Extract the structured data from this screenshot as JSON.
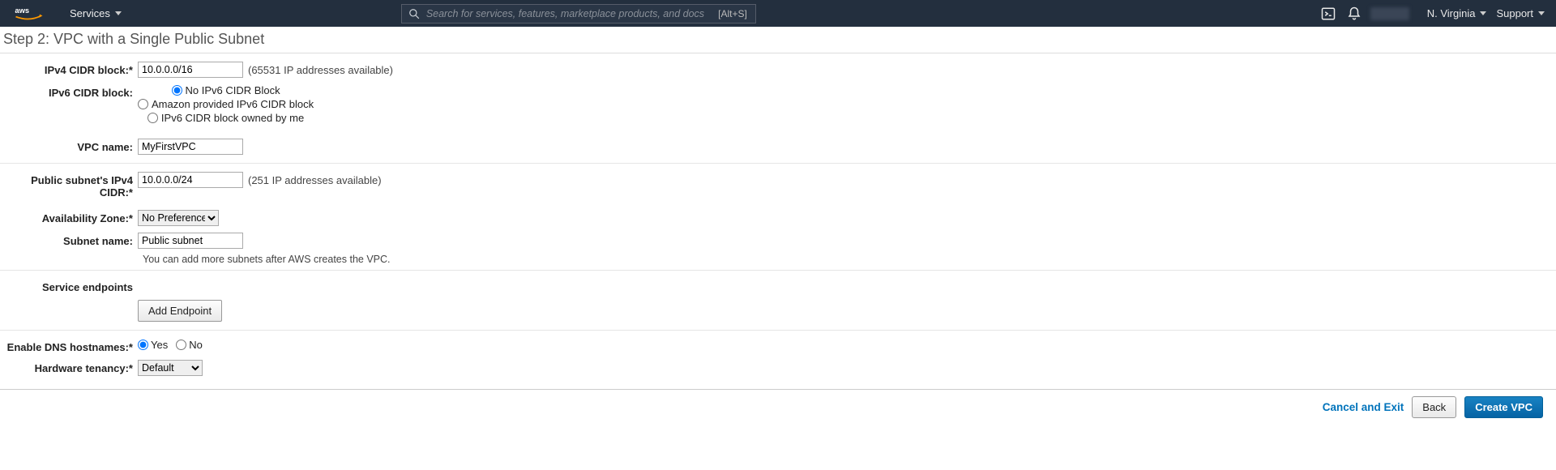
{
  "nav": {
    "services_label": "Services",
    "search_placeholder": "Search for services, features, marketplace products, and docs",
    "search_kbd": "[Alt+S]",
    "region": "N. Virginia",
    "support": "Support"
  },
  "page": {
    "title": "Step 2: VPC with a Single Public Subnet"
  },
  "form": {
    "ipv4_label": "IPv4 CIDR block:*",
    "ipv4_value": "10.0.0.0/16",
    "ipv4_help": "(65531 IP addresses available)",
    "ipv6_label": "IPv6 CIDR block:",
    "ipv6_opt_none": "No IPv6 CIDR Block",
    "ipv6_opt_amazon": "Amazon provided IPv6 CIDR block",
    "ipv6_opt_owned": "IPv6 CIDR block owned by me",
    "vpc_name_label": "VPC name:",
    "vpc_name_value": "MyFirstVPC",
    "ps_ipv4_label": "Public subnet's IPv4 CIDR:*",
    "ps_ipv4_value": "10.0.0.0/24",
    "ps_ipv4_help": "(251 IP addresses available)",
    "az_label": "Availability Zone:*",
    "az_value": "No Preference",
    "subnet_name_label": "Subnet name:",
    "subnet_name_value": "Public subnet",
    "subnet_hint": "You can add more subnets after AWS creates the VPC.",
    "se_label": "Service endpoints",
    "add_endpoint_btn": "Add Endpoint",
    "dns_label": "Enable DNS hostnames:*",
    "dns_yes": "Yes",
    "dns_no": "No",
    "tenancy_label": "Hardware tenancy:*",
    "tenancy_value": "Default"
  },
  "footer": {
    "cancel": "Cancel and Exit",
    "back": "Back",
    "create": "Create VPC"
  }
}
